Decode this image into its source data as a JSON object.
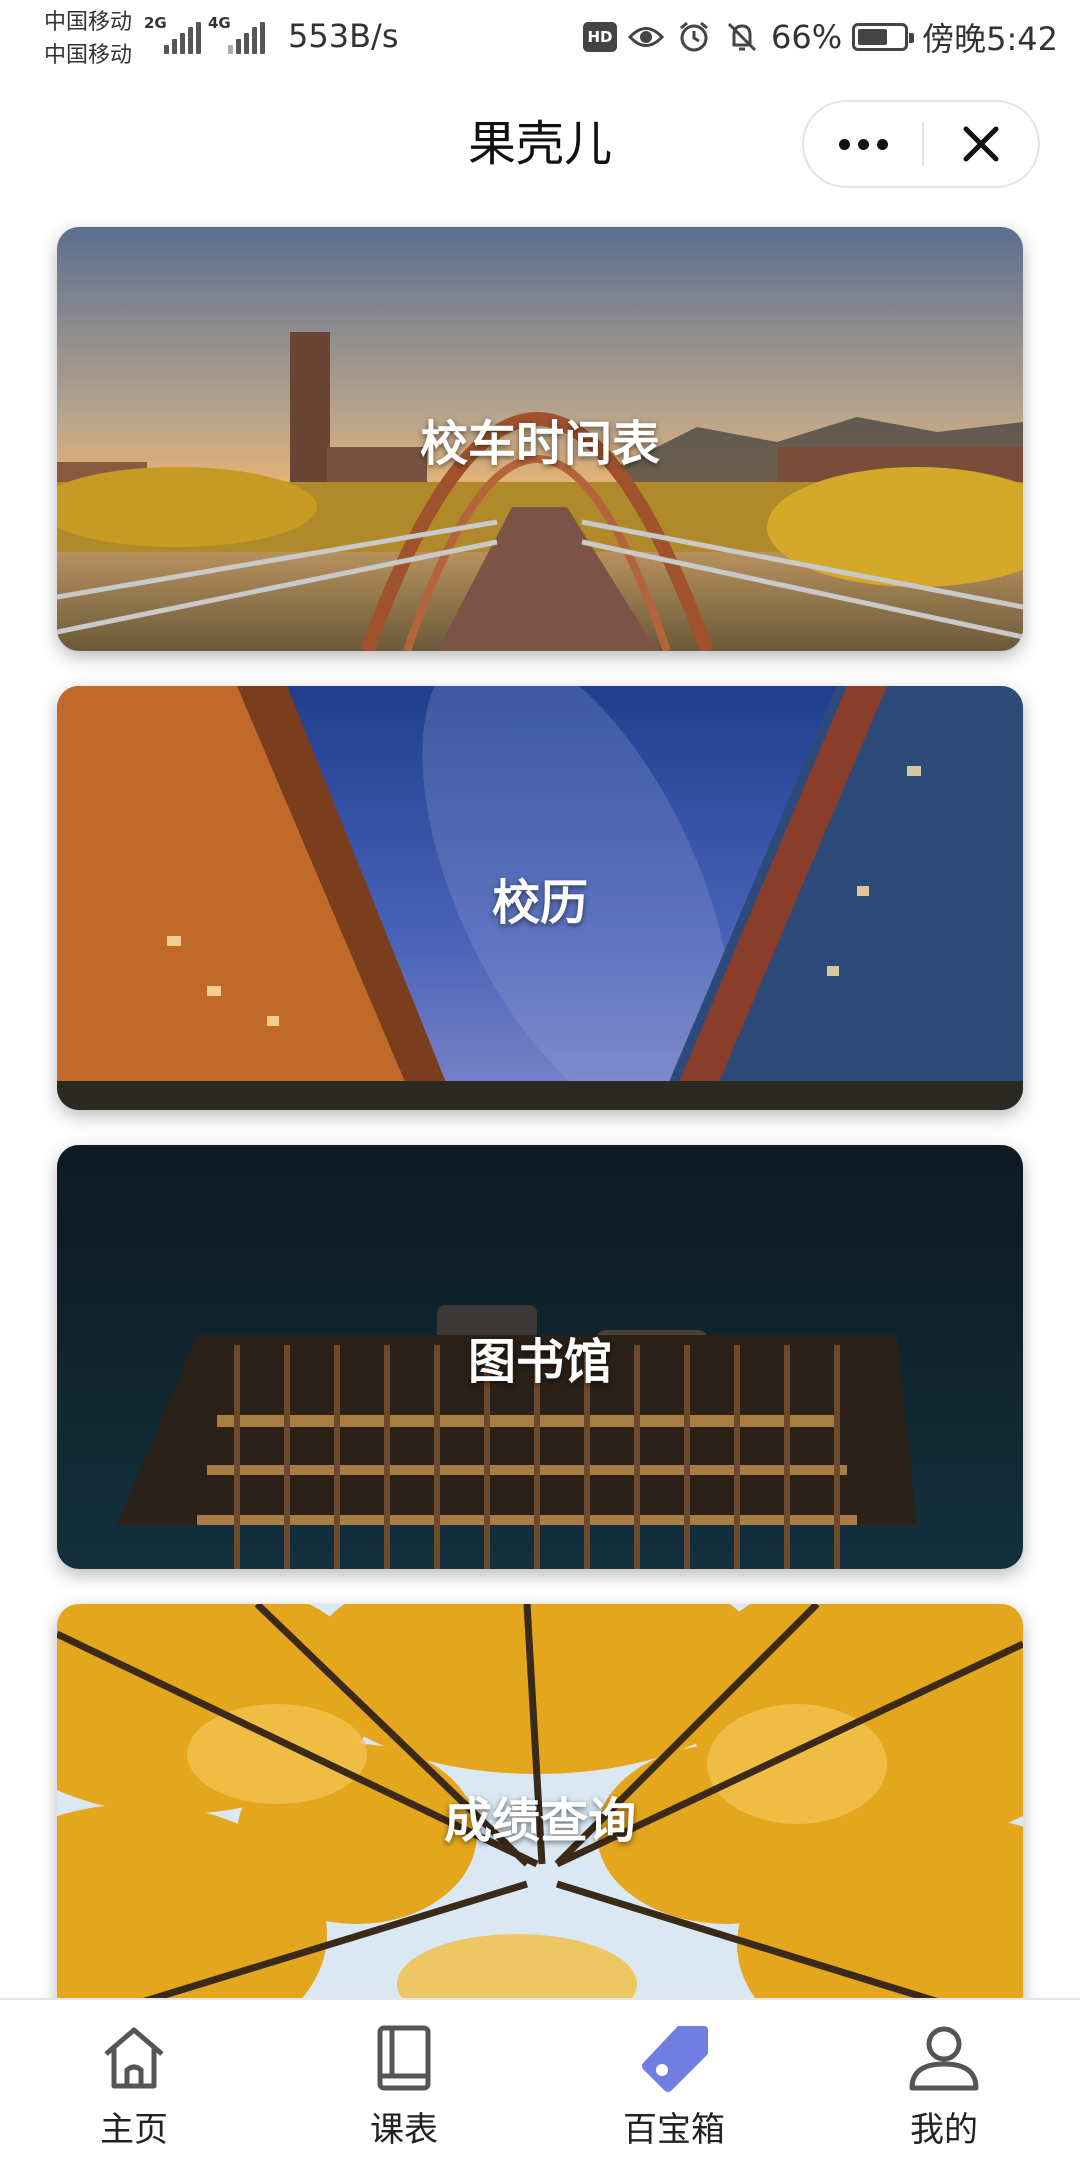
{
  "status_bar": {
    "carrier1": "中国移动",
    "carrier2": "中国移动",
    "net1": "2G",
    "net2": "4G",
    "speed": "553B/s",
    "hd": "HD",
    "battery": "66%",
    "battery_level": 0.66,
    "time": "傍晚5:42"
  },
  "header": {
    "title": "果壳儿"
  },
  "cards": [
    {
      "label": "校车时间表"
    },
    {
      "label": "校历"
    },
    {
      "label": "图书馆"
    },
    {
      "label": "成绩查询"
    }
  ],
  "tabbar": {
    "items": [
      {
        "label": "主页",
        "icon": "home-icon"
      },
      {
        "label": "课表",
        "icon": "book-icon"
      },
      {
        "label": "百宝箱",
        "icon": "tag-icon"
      },
      {
        "label": "我的",
        "icon": "user-icon"
      }
    ],
    "active_index": 2,
    "active_color": "#6f7ee0"
  }
}
